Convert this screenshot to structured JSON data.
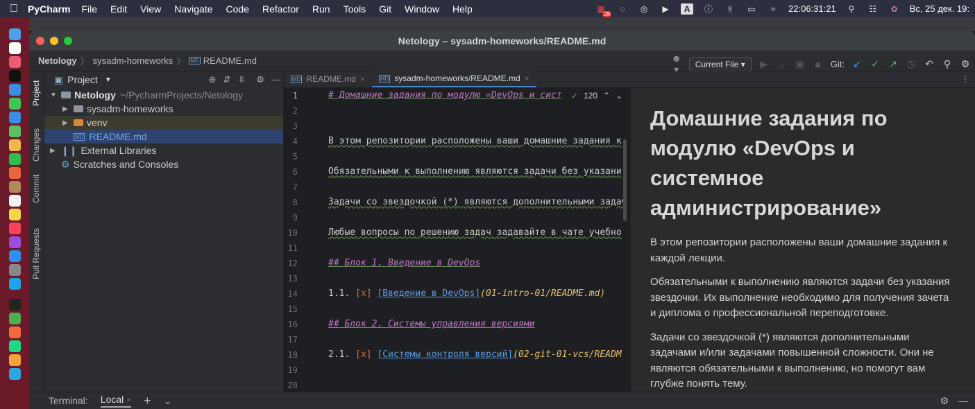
{
  "menubar": {
    "app": "PyCharm",
    "menus": [
      "File",
      "Edit",
      "View",
      "Navigate",
      "Code",
      "Refactor",
      "Run",
      "Tools",
      "Git",
      "Window",
      "Help"
    ],
    "badge": "28",
    "clock": "22:06:31:21",
    "date": "Вс, 25 дек. 19:"
  },
  "window": {
    "title": "Netology – sysadm-homeworks/README.md"
  },
  "breadcrumb": {
    "items": [
      "Netology",
      "sysadm-homeworks",
      "README.md"
    ]
  },
  "toolbar": {
    "run_config": "Current File",
    "git_label": "Git:"
  },
  "side_tabs": [
    "Project",
    "Changes",
    "Commit",
    "Pull Requests"
  ],
  "project": {
    "title": "Project",
    "root": "Netology",
    "root_path": "~/PycharmProjects/Netology",
    "children": [
      "sysadm-homeworks",
      "venv",
      "README.md"
    ],
    "external": "External Libraries",
    "scratches": "Scratches and Consoles"
  },
  "editor": {
    "tabs": [
      "README.md",
      "sysadm-homeworks/README.md"
    ],
    "line_numbers": [
      "1",
      "2",
      "3",
      "4",
      "5",
      "6",
      "7",
      "8",
      "9",
      "10",
      "11",
      "12",
      "13",
      "14",
      "15",
      "16",
      "17",
      "18",
      "19",
      "20"
    ],
    "inspection_count": "120",
    "lines": {
      "l1": "# Домашние задания по модулю «DevOps и сист",
      "l4": "В этом репозитории расположены ваши домашние задания к",
      "l6": "Обязательными к выполнению являются задачи без указани",
      "l8": "Задачи со звездочкой (*) являются дополнительными задач",
      "l10": "Любые вопросы по решению задач задавайте в чате учебно",
      "l12": "## Блок 1. Введение в DevOps",
      "l14_num": "1.1. ",
      "l14_chk": "[x] ",
      "l14_link": "[Введение в DevOps]",
      "l14_path": "(01-intro-01/README.md)",
      "l16": "## Блок 2. Системы управления версиями",
      "l18_num": "2.1. ",
      "l18_chk": "[x] ",
      "l18_link": "[Системы контроля версий]",
      "l18_path": "(02-git-01-vcs/READM"
    }
  },
  "preview": {
    "heading": "Домашние задания по модулю «DevOps и системное администрирование»",
    "p1": "В этом репозитории расположены ваши домашние задания к каждой лекции.",
    "p2": "Обязательными к выполнению являются задачи без указания звездочки. Их выполнение необходимо для получения зачета и диплома о профессиональной переподготовке.",
    "p3": "Задачи со звездочкой (*) являются дополнительными задачами и/или задачами повышенной сложности. Они не являются обязательными к выполнению, но помогут вам глубже понять тему."
  },
  "terminal": {
    "label": "Terminal:",
    "tab": "Local"
  }
}
